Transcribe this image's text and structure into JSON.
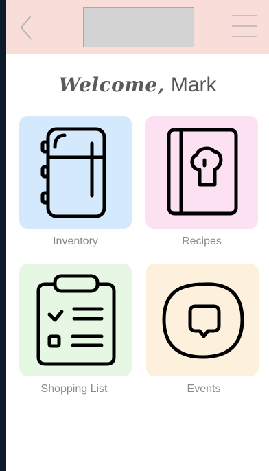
{
  "header": {
    "back_icon": "chevron-left-icon",
    "menu_icon": "hamburger-menu-icon",
    "background_color": "#f9ddd8"
  },
  "welcome": {
    "greeting": "Welcome,",
    "name": "Mark"
  },
  "tiles": [
    {
      "label": "Inventory",
      "icon": "refrigerator-icon",
      "color": "#d4e9fb"
    },
    {
      "label": "Recipes",
      "icon": "recipe-book-icon",
      "color": "#fbe1f2"
    },
    {
      "label": "Shopping List",
      "icon": "clipboard-checklist-icon",
      "color": "#e6f8e3"
    },
    {
      "label": "Events",
      "icon": "chat-bubble-icon",
      "color": "#fdf1dd"
    }
  ]
}
